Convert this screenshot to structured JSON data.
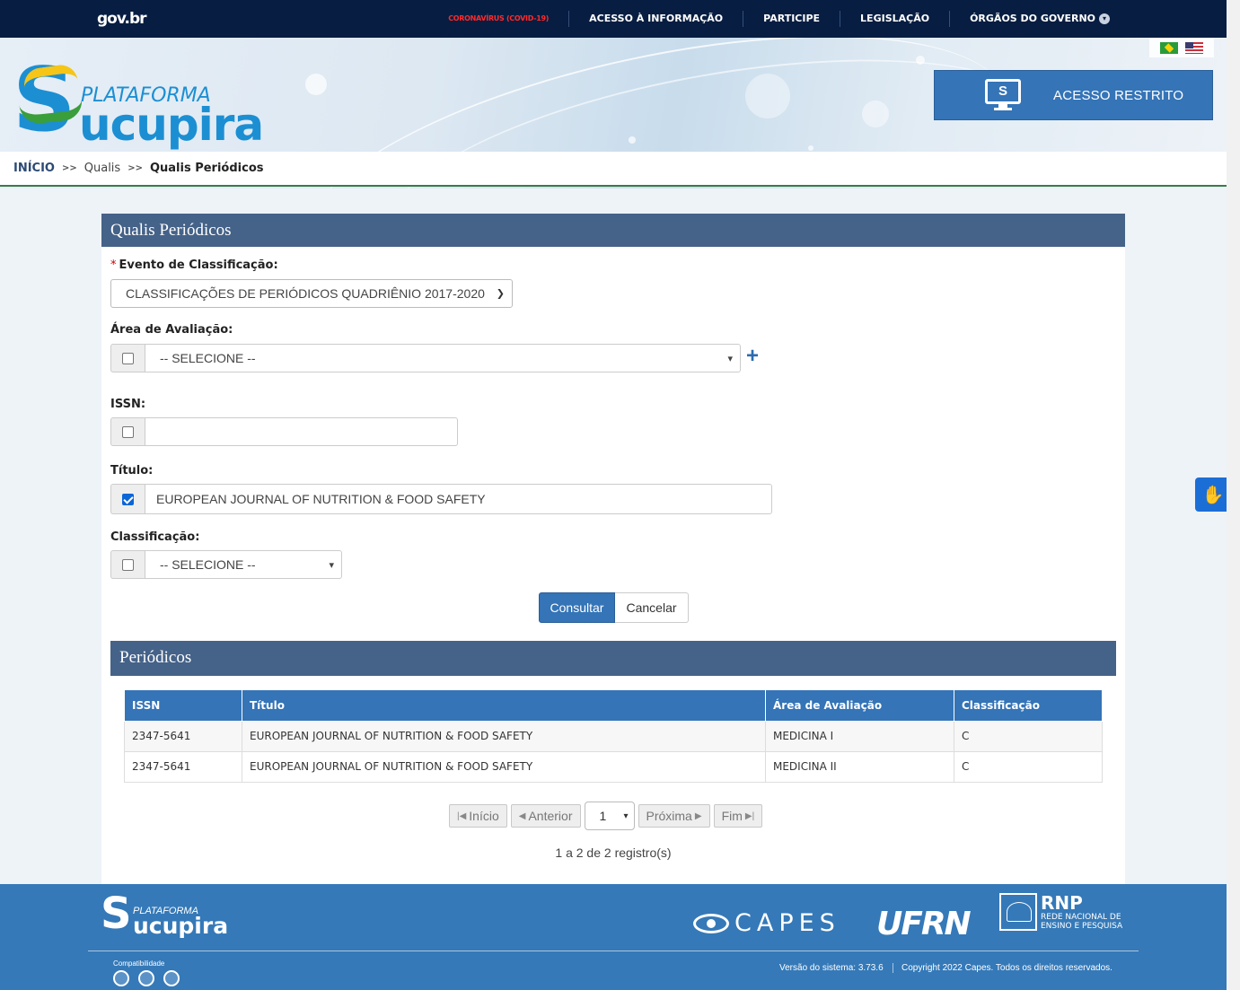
{
  "govbar": {
    "logo": "gov.br",
    "nav": [
      "CORONAVÍRUS (COVID-19)",
      "ACESSO À INFORMAÇÃO",
      "PARTICIPE",
      "LEGISLAÇÃO",
      "ÓRGÃOS DO GOVERNO"
    ]
  },
  "header": {
    "brand_small": "PLATAFORMA",
    "brand_big": "ucupira",
    "brand_s": "S",
    "acesso_label": "ACESSO RESTRITO",
    "acesso_icon_letter": "S"
  },
  "breadcrumb": {
    "home": "INÍCIO",
    "sep": ">>",
    "mid": "Qualis",
    "current": "Qualis Periódicos"
  },
  "form": {
    "title": "Qualis Periódicos",
    "evento_label": "Evento de Classificação:",
    "evento_required": "*",
    "evento_value": "CLASSIFICAÇÕES DE PERIÓDICOS QUADRIÊNIO 2017-2020",
    "area_label": "Área de Avaliação:",
    "area_value": "-- SELECIONE --",
    "area_checked": false,
    "issn_label": "ISSN:",
    "issn_value": "",
    "issn_checked": false,
    "titulo_label": "Título:",
    "titulo_value": "EUROPEAN JOURNAL OF NUTRITION & FOOD SAFETY",
    "titulo_checked": true,
    "classificacao_label": "Classificação:",
    "classificacao_value": "-- SELECIONE --",
    "classificacao_checked": false,
    "consultar": "Consultar",
    "cancelar": "Cancelar"
  },
  "results": {
    "title": "Periódicos",
    "columns": [
      "ISSN",
      "Título",
      "Área de Avaliação",
      "Classificação"
    ],
    "rows": [
      [
        "2347-5641",
        "EUROPEAN JOURNAL OF NUTRITION & FOOD SAFETY",
        "MEDICINA I",
        "C"
      ],
      [
        "2347-5641",
        "EUROPEAN JOURNAL OF NUTRITION & FOOD SAFETY",
        "MEDICINA II",
        "C"
      ]
    ]
  },
  "pager": {
    "inicio": "Início",
    "anterior": "Anterior",
    "page": "1",
    "proxima": "Próxima",
    "fim": "Fim",
    "count": "1 a 2 de 2 registro(s)"
  },
  "footer": {
    "brand_small": "PLATAFORMA",
    "brand_big": "ucupira",
    "brand_s": "S",
    "capes": "CAPES",
    "ufrn": "UFRN",
    "rnp_title": "RNP",
    "rnp_sub1": "REDE NACIONAL DE",
    "rnp_sub2": "ENSINO E PESQUISA",
    "compat": "Compatibilidade",
    "versao": "Versão do sistema: 3.73.6",
    "copyright": "Copyright 2022 Capes. Todos os direitos reservados."
  },
  "colors": {
    "govbar": "#071d41",
    "panel_header": "#456288",
    "primary": "#3474b7",
    "covid": "#ff2a2a"
  }
}
